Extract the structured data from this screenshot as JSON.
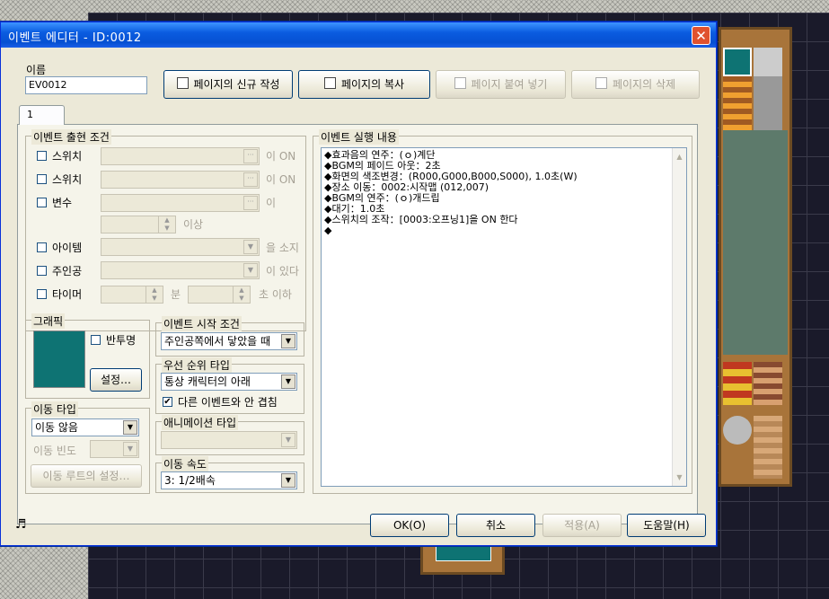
{
  "window": {
    "title": "이벤트 에디터 - ID:0012",
    "close": "✕"
  },
  "name_group": {
    "label": "이름",
    "value": "EV0012"
  },
  "toolbar": {
    "new_page": "페이지의 신규 작성",
    "copy_page": "페이지의 복사",
    "paste_page": "페이지 붙여 넣기",
    "delete_page": "페이지의 삭제"
  },
  "tabs": [
    {
      "label": "1"
    }
  ],
  "conditions": {
    "label": "이벤트 출현 조건",
    "switch1": "스위치",
    "switch1_suffix": "이 ON",
    "switch2": "스위치",
    "switch2_suffix": "이 ON",
    "variable": "변수",
    "variable_suffix": "이",
    "variable_more": "이상",
    "item": "아이템",
    "item_suffix": "을 소지",
    "hero": "주인공",
    "hero_suffix": "이 있다",
    "timer": "타이머",
    "timer_min": "분",
    "timer_suffix": "초 이하"
  },
  "graphic": {
    "label": "그래픽",
    "translucent": "반투명",
    "set_button": "설정…",
    "color": "#0e7373"
  },
  "start_condition": {
    "label": "이벤트 시작 조건",
    "value": "주인공쪽에서 닿았을 때"
  },
  "priority": {
    "label": "우선 순위 타입",
    "value": "통상 캐릭터의 아래",
    "no_overlap": "다른 이벤트와 안 겹침",
    "no_overlap_checked": "✔"
  },
  "move_type": {
    "label": "이동 타입",
    "value": "이동 않음",
    "freq_label": "이동 빈도",
    "route_button": "이동 루트의 설정…"
  },
  "animation": {
    "label": "애니메이션 타입",
    "value": ""
  },
  "move_speed": {
    "label": "이동 속도",
    "value": "3: 1/2배속"
  },
  "events": {
    "label": "이벤트 실행 내용",
    "lines": [
      "◆효과음의 연주：(ｏ)계단",
      "◆BGM의 페이드 아웃：2초",
      "◆화면의 색조변경：(R000,G000,B000,S000), 1.0초(W)",
      "◆장소 이동：0002:시작맵 (012,007)",
      "◆BGM의 연주：(ｏ)개드립",
      "◆대기：1.0초",
      "◆스위치의 조작：[0003:오프닝1]을 ON 한다",
      "◆"
    ]
  },
  "footer": {
    "music_icon": "♬",
    "ok": "OK(O)",
    "cancel": "취소",
    "apply": "적용(A)",
    "help": "도움말(H)"
  }
}
